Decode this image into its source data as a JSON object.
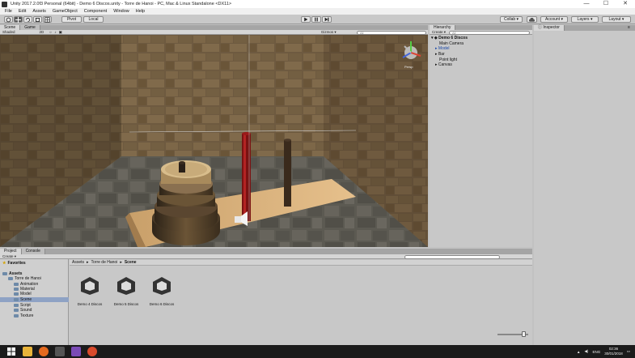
{
  "window": {
    "title": "Unity 2017.2.0f3 Personal (64bit) - Demo 6 Discos.unity - Torre de Hanoi - PC, Mac & Linux Standalone <DX11>",
    "controls": [
      "—",
      "☐",
      "✕"
    ]
  },
  "menu": [
    "File",
    "Edit",
    "Assets",
    "GameObject",
    "Component",
    "Window",
    "Help"
  ],
  "toolbar": {
    "pivot": "Pivot",
    "local": "Local",
    "collab": "Collab ▾",
    "account": "Account ▾",
    "layers": "Layers ▾",
    "layout": "Layout ▾",
    "play_icon": "play-icon",
    "pause_icon": "pause-icon",
    "step_icon": "step-icon"
  },
  "scene_panel": {
    "tabs": [
      "Scene",
      "Game"
    ],
    "shading": "Shaded",
    "mode2d": "2D",
    "gizmos": "Gizmos ▾",
    "search_placeholder": "All",
    "gizmo_label": "Persp"
  },
  "hierarchy": {
    "tab": "Hierarchy",
    "create": "Create ▾",
    "search_placeholder": "All",
    "scene_name": "Demo 6 Discos",
    "items": [
      "Main Camera",
      "Model",
      "Bar",
      "Point light",
      "Canvas"
    ]
  },
  "inspector": {
    "tab": "Inspector"
  },
  "project": {
    "tabs": [
      "Project",
      "Console"
    ],
    "create": "Create ▾",
    "favorites": "Favorites",
    "assets": "Assets",
    "tree": [
      "Torre de Hanoi",
      "Animation",
      "Material",
      "Model",
      "Scene",
      "Script",
      "Sound",
      "Texture"
    ],
    "selected": "Scene",
    "breadcrumb": [
      "Assets",
      "Torre de Hanoi",
      "Scene"
    ],
    "files": [
      "Demo 4 Discos",
      "Demo 5 Discos",
      "Demo 6 Discos"
    ]
  },
  "taskbar": {
    "lang": "ENG",
    "time": "02:36",
    "date": "30/01/2018"
  }
}
